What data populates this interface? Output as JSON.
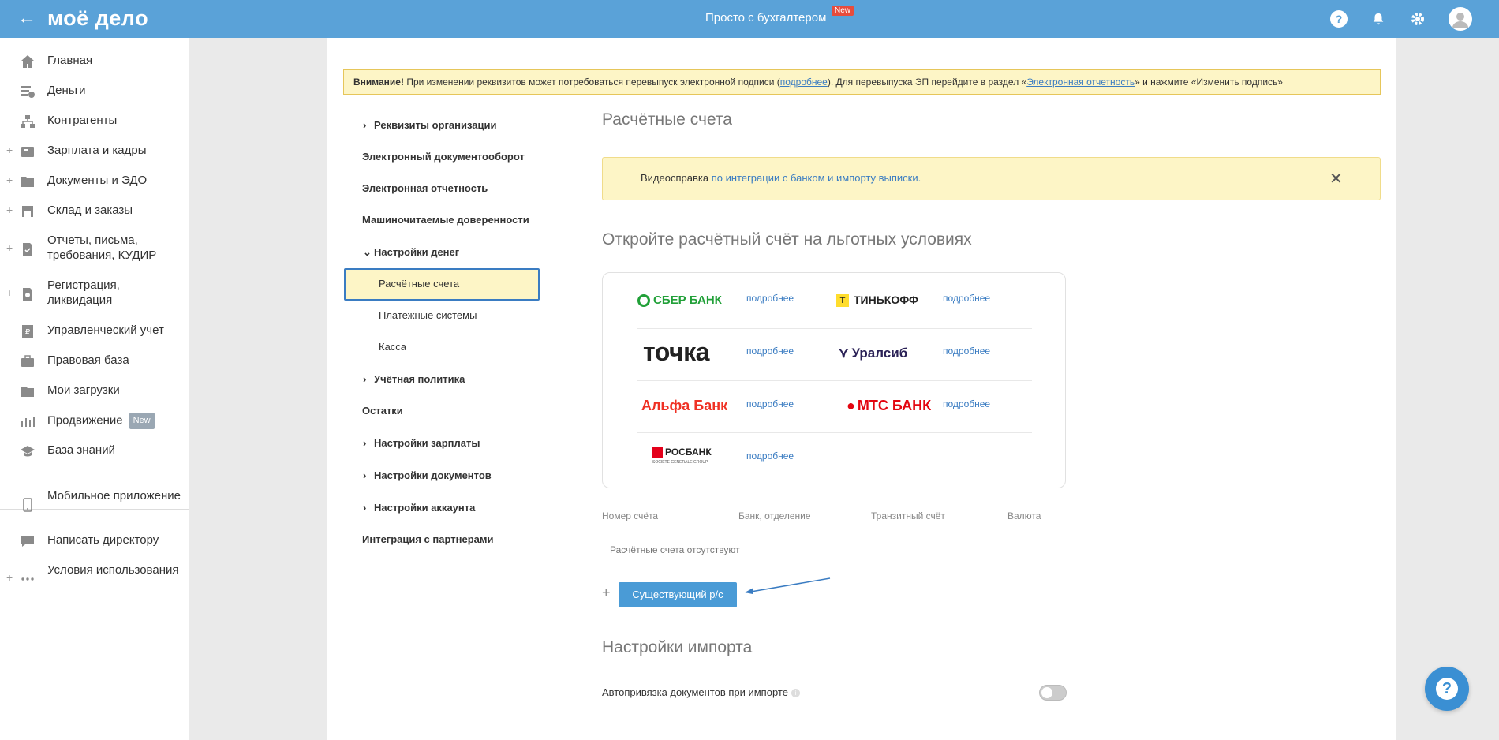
{
  "header": {
    "logo": "моё дело",
    "center_title": "Просто с бухгалтером",
    "new_badge": "New",
    "icons": [
      "help-icon",
      "bell-icon",
      "gear-icon",
      "avatar-icon"
    ]
  },
  "sidebar": {
    "items": [
      {
        "label": "Главная",
        "icon": "home-icon"
      },
      {
        "label": "Деньги",
        "icon": "money-icon"
      },
      {
        "label": "Контрагенты",
        "icon": "org-icon"
      },
      {
        "label": "Зарплата и кадры",
        "icon": "salary-icon"
      },
      {
        "label": "Документы и ЭДО",
        "icon": "folder-icon"
      },
      {
        "label": "Склад и заказы",
        "icon": "warehouse-icon"
      },
      {
        "label": "Отчеты, письма, требования, КУДИР",
        "icon": "report-icon"
      },
      {
        "label": "Регистрация, ликвидация",
        "icon": "registration-icon"
      },
      {
        "label": "Управленческий учет",
        "icon": "ruble-doc-icon"
      },
      {
        "label": "Правовая база",
        "icon": "briefcase-icon"
      },
      {
        "label": "Мои загрузки",
        "icon": "folder-icon"
      },
      {
        "label": "Продвижение",
        "icon": "chart-icon",
        "badge": "New"
      },
      {
        "label": "База знаний",
        "icon": "graduation-icon"
      },
      {
        "label": "Мобильное приложение",
        "icon": "mobile-icon"
      },
      {
        "label": "Написать директору",
        "icon": "chat-icon"
      },
      {
        "label": "Условия использования",
        "icon": "more-icon"
      }
    ]
  },
  "warning": {
    "bold": "Внимание!",
    "text1": " При изменении реквизитов может потребоваться перевыпуск электронной подписи (",
    "link1": "подробнее",
    "text2": "). Для перевыпуска ЭП перейдите в раздел «",
    "link2": "Электронная отчетность",
    "text3": "» и нажмите «Изменить подпись»"
  },
  "settings_nav": {
    "items": [
      "Реквизиты организации",
      "Электронный документооборот",
      "Электронная отчетность",
      "Машиночитаемые доверенности",
      "Настройки денег",
      "Расчётные счета",
      "Платежные системы",
      "Касса",
      "Учётная политика",
      "Остатки",
      "Настройки зарплаты",
      "Настройки документов",
      "Настройки аккаунта",
      "Интеграция с партнерами"
    ]
  },
  "main": {
    "title": "Расчётные счета",
    "video_text": "Видеосправка ",
    "video_link": "по интеграции с банком и импорту выписки.",
    "close": "✕",
    "promo_title": "Откройте расчётный счёт на льготных условиях",
    "banks": [
      "СБЕР БАНК",
      "ТИНЬКОФФ",
      "точка",
      "Уралсиб",
      "Альфа Банк",
      "МТС БАНК",
      "РОСБАНК"
    ],
    "rosbank_sub": "SOCIETE GENERALE GROUP",
    "more_label": "подробнее",
    "table_headers": [
      "Номер счёта",
      "Банк, отделение",
      "Транзитный счёт",
      "Валюта"
    ],
    "empty_text": "Расчётные счета отсутствуют",
    "add_button": "Существующий р/с",
    "import_title": "Настройки импорта",
    "autolink_label": "Автопривязка документов при импорте",
    "autolink_enabled": false
  }
}
